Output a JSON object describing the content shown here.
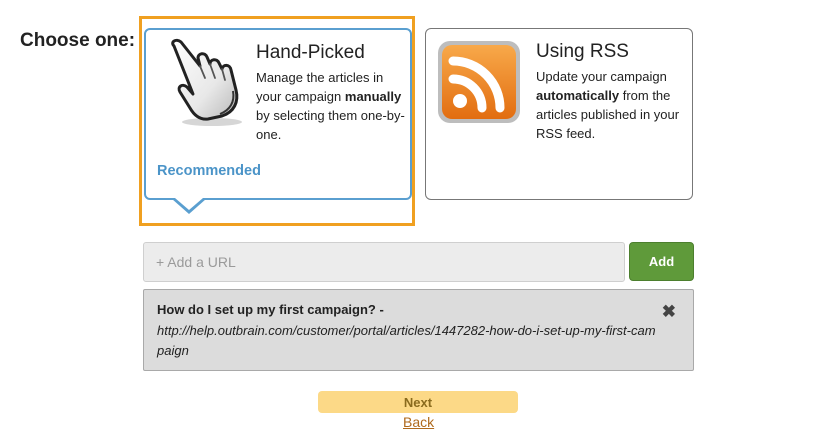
{
  "page": {
    "choose_label": "Choose one:"
  },
  "options": {
    "hand_picked": {
      "title": "Hand-Picked",
      "desc_before": "Manage the articles in your campaign ",
      "desc_bold": "manually",
      "desc_after": " by selecting them one-by-one.",
      "badge": "Recommended",
      "icon": "pointing-hand-icon",
      "selected": true
    },
    "rss": {
      "title": "Using RSS",
      "desc_before": "Update your campaign ",
      "desc_bold": "automatically",
      "desc_after": " from the articles published in your RSS feed.",
      "icon": "rss-feed-icon",
      "selected": false
    }
  },
  "url_form": {
    "placeholder": "+ Add a URL",
    "value": "",
    "add_label": "Add"
  },
  "url_list": [
    {
      "title": "How do I set up my first campaign? -",
      "url": "http://help.outbrain.com/customer/portal/articles/1447282-how-do-i-set-up-my-first-campaign",
      "remove_glyph": "✖"
    }
  ],
  "footer": {
    "next_label": "Next",
    "back_label": "Back"
  },
  "colors": {
    "selected_frame": "#f0a020",
    "selected_border": "#5a9fd0",
    "recommended": "#4b94c8",
    "add_button": "#5f9a3a",
    "next_button": "#fcd987",
    "back_link": "#b06a1c",
    "rss_orange": "#f08a1e"
  }
}
